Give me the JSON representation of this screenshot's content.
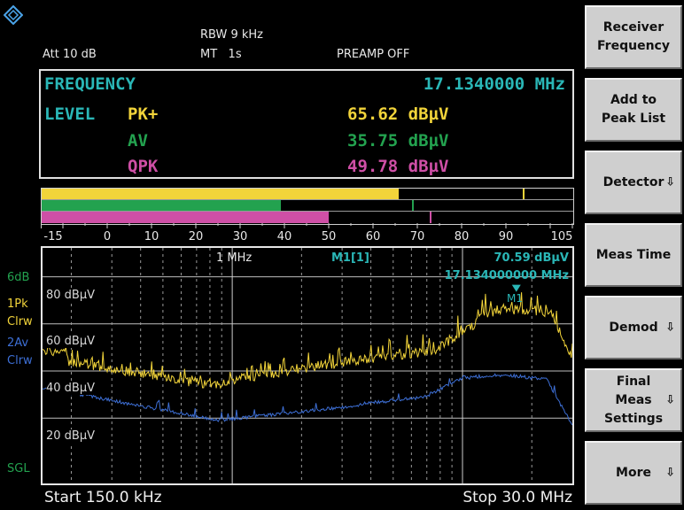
{
  "header": {
    "att": "Att  10 dB",
    "rbw": "RBW 9 kHz",
    "mt": "MT   1s",
    "preamp": "PREAMP OFF"
  },
  "readout": {
    "frequency_label": "FREQUENCY",
    "frequency_value": "17.1340000 MHz",
    "level_label": "LEVEL",
    "rows": [
      {
        "detector": "PK+",
        "value": "65.62 dBµV",
        "color": "#f2d43a"
      },
      {
        "detector": "AV",
        "value": "35.75 dBµV",
        "color": "#23a24f"
      },
      {
        "detector": "QPK",
        "value": "49.78 dBµV",
        "color": "#cf4fa6"
      }
    ]
  },
  "bargraph": {
    "scale": [
      "-15",
      "0",
      "10",
      "20",
      "30",
      "40",
      "50",
      "60",
      "70",
      "80",
      "90",
      "105"
    ],
    "pk_level": 65.62,
    "pk_peak": 93.5,
    "av_level": 39.0,
    "av_peak": 68.5,
    "qpk_level": 49.78,
    "qpk_peak": 72.5
  },
  "plot": {
    "freq_marker_label": "1 MHz",
    "marker_label": "M1[1]",
    "marker_value": "70.59 dBµV",
    "marker_freq": "17.134000000 MHz",
    "marker_tag": "M1",
    "y_labels": [
      "80 dBµV",
      "60 dBµV",
      "40 dBµV",
      "20 dBµV"
    ],
    "start": "Start 150.0 kHz",
    "stop": "Stop 30.0 MHz"
  },
  "side_labels": {
    "db": "6dB",
    "trace1_a": "1Pk",
    "trace1_b": "Clrw",
    "trace2_a": "2Av",
    "trace2_b": "Clrw",
    "sgl": "SGL"
  },
  "softkeys": [
    {
      "label": "Receiver\nFrequency",
      "arrow": ""
    },
    {
      "label": "Add to\nPeak List",
      "arrow": ""
    },
    {
      "label": "Detector",
      "arrow": "⇩"
    },
    {
      "label": "Meas Time",
      "arrow": ""
    },
    {
      "label": "Demod",
      "arrow": "⇩"
    },
    {
      "label": "Final\nMeas\nSettings",
      "arrow": "⇩"
    },
    {
      "label": "More",
      "arrow": "⇩"
    }
  ],
  "colors": {
    "cyan": "#2ab7b7",
    "yellow": "#f2d43a",
    "green": "#23a24f",
    "pink": "#cf4fa6",
    "blue": "#3d6fd6"
  }
}
